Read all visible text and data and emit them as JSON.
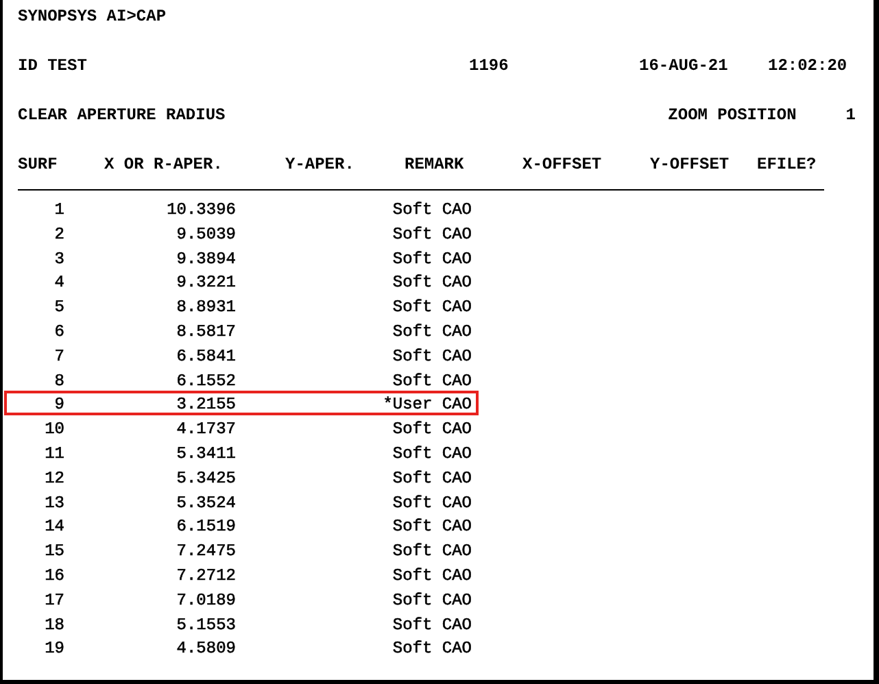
{
  "prompt": "SYNOPSYS AI>CAP",
  "info": {
    "title": "ID TEST",
    "number": "1196",
    "date": "16-AUG-21",
    "time": "12:02:20"
  },
  "section": {
    "title": "CLEAR APERTURE RADIUS",
    "zoom_label": "ZOOM POSITION",
    "zoom_value": "1"
  },
  "table": {
    "columns": [
      "SURF",
      "X OR R-APER.",
      "Y-APER.",
      "REMARK",
      "X-OFFSET",
      "Y-OFFSET",
      "EFILE?"
    ],
    "rows": [
      {
        "surf": "1",
        "x_aper": "10.3396",
        "remark": "Soft CAO",
        "highlighted": false
      },
      {
        "surf": "2",
        "x_aper": "9.5039",
        "remark": "Soft CAO",
        "highlighted": false
      },
      {
        "surf": "3",
        "x_aper": "9.3894",
        "remark": "Soft CAO",
        "highlighted": false
      },
      {
        "surf": "4",
        "x_aper": "9.3221",
        "remark": "Soft CAO",
        "highlighted": false
      },
      {
        "surf": "5",
        "x_aper": "8.8931",
        "remark": "Soft CAO",
        "highlighted": false
      },
      {
        "surf": "6",
        "x_aper": "8.5817",
        "remark": "Soft CAO",
        "highlighted": false
      },
      {
        "surf": "7",
        "x_aper": "6.5841",
        "remark": "Soft CAO",
        "highlighted": false
      },
      {
        "surf": "8",
        "x_aper": "6.1552",
        "remark": "Soft CAO",
        "highlighted": false
      },
      {
        "surf": "9",
        "x_aper": "3.2155",
        "remark": "*User CAO",
        "highlighted": true
      },
      {
        "surf": "10",
        "x_aper": "4.1737",
        "remark": "Soft CAO",
        "highlighted": false
      },
      {
        "surf": "11",
        "x_aper": "5.3411",
        "remark": "Soft CAO",
        "highlighted": false
      },
      {
        "surf": "12",
        "x_aper": "5.3425",
        "remark": "Soft CAO",
        "highlighted": false
      },
      {
        "surf": "13",
        "x_aper": "5.3524",
        "remark": "Soft CAO",
        "highlighted": false
      },
      {
        "surf": "14",
        "x_aper": "6.1519",
        "remark": "Soft CAO",
        "highlighted": false
      },
      {
        "surf": "15",
        "x_aper": "7.2475",
        "remark": "Soft CAO",
        "highlighted": false
      },
      {
        "surf": "16",
        "x_aper": "7.2712",
        "remark": "Soft CAO",
        "highlighted": false
      },
      {
        "surf": "17",
        "x_aper": "7.0189",
        "remark": "Soft CAO",
        "highlighted": false
      },
      {
        "surf": "18",
        "x_aper": "5.1553",
        "remark": "Soft CAO",
        "highlighted": false
      },
      {
        "surf": "19",
        "x_aper": "4.5809",
        "remark": "Soft CAO",
        "highlighted": false
      }
    ]
  }
}
